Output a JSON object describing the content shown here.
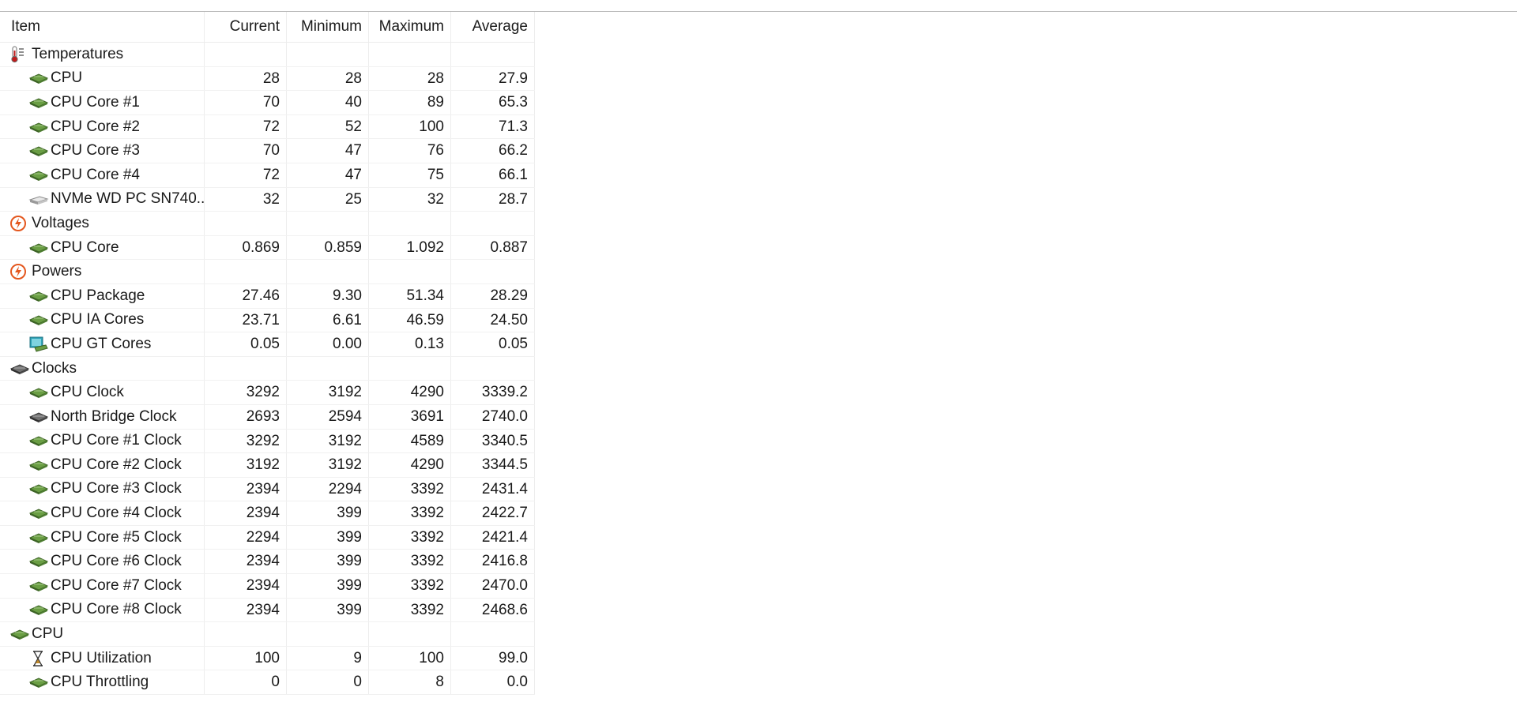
{
  "columns": {
    "item": "Item",
    "current": "Current",
    "minimum": "Minimum",
    "maximum": "Maximum",
    "average": "Average"
  },
  "rows": [
    {
      "kind": "category",
      "icon": "thermometer-icon",
      "label": "Temperatures",
      "current": "",
      "minimum": "",
      "maximum": "",
      "average": ""
    },
    {
      "kind": "item",
      "icon": "chip-icon",
      "label": "CPU",
      "current": "28",
      "minimum": "28",
      "maximum": "28",
      "average": "27.9"
    },
    {
      "kind": "item",
      "icon": "chip-icon",
      "label": "CPU Core #1",
      "current": "70",
      "minimum": "40",
      "maximum": "89",
      "average": "65.3"
    },
    {
      "kind": "item",
      "icon": "chip-icon",
      "label": "CPU Core #2",
      "current": "72",
      "minimum": "52",
      "maximum": "100",
      "average": "71.3"
    },
    {
      "kind": "item",
      "icon": "chip-icon",
      "label": "CPU Core #3",
      "current": "70",
      "minimum": "47",
      "maximum": "76",
      "average": "66.2"
    },
    {
      "kind": "item",
      "icon": "chip-icon",
      "label": "CPU Core #4",
      "current": "72",
      "minimum": "47",
      "maximum": "75",
      "average": "66.1"
    },
    {
      "kind": "item",
      "icon": "drive-icon",
      "label": "NVMe WD PC SN740...",
      "current": "32",
      "minimum": "25",
      "maximum": "32",
      "average": "28.7"
    },
    {
      "kind": "category",
      "icon": "lightning-icon",
      "label": "Voltages",
      "current": "",
      "minimum": "",
      "maximum": "",
      "average": ""
    },
    {
      "kind": "item",
      "icon": "chip-icon",
      "label": "CPU Core",
      "current": "0.869",
      "minimum": "0.859",
      "maximum": "1.092",
      "average": "0.887"
    },
    {
      "kind": "category",
      "icon": "lightning-icon",
      "label": "Powers",
      "current": "",
      "minimum": "",
      "maximum": "",
      "average": ""
    },
    {
      "kind": "item",
      "icon": "chip-icon",
      "label": "CPU Package",
      "current": "27.46",
      "minimum": "9.30",
      "maximum": "51.34",
      "average": "28.29"
    },
    {
      "kind": "item",
      "icon": "chip-icon",
      "label": "CPU IA Cores",
      "current": "23.71",
      "minimum": "6.61",
      "maximum": "46.59",
      "average": "24.50"
    },
    {
      "kind": "item",
      "icon": "gpu-icon",
      "label": "CPU GT Cores",
      "current": "0.05",
      "minimum": "0.00",
      "maximum": "0.13",
      "average": "0.05"
    },
    {
      "kind": "category",
      "icon": "dark-chip-icon",
      "label": "Clocks",
      "current": "",
      "minimum": "",
      "maximum": "",
      "average": ""
    },
    {
      "kind": "item",
      "icon": "chip-icon",
      "label": "CPU Clock",
      "current": "3292",
      "minimum": "3192",
      "maximum": "4290",
      "average": "3339.2"
    },
    {
      "kind": "item",
      "icon": "dark-chip-icon",
      "label": "North Bridge Clock",
      "current": "2693",
      "minimum": "2594",
      "maximum": "3691",
      "average": "2740.0"
    },
    {
      "kind": "item",
      "icon": "chip-icon",
      "label": "CPU Core #1 Clock",
      "current": "3292",
      "minimum": "3192",
      "maximum": "4589",
      "average": "3340.5"
    },
    {
      "kind": "item",
      "icon": "chip-icon",
      "label": "CPU Core #2 Clock",
      "current": "3192",
      "minimum": "3192",
      "maximum": "4290",
      "average": "3344.5"
    },
    {
      "kind": "item",
      "icon": "chip-icon",
      "label": "CPU Core #3 Clock",
      "current": "2394",
      "minimum": "2294",
      "maximum": "3392",
      "average": "2431.4"
    },
    {
      "kind": "item",
      "icon": "chip-icon",
      "label": "CPU Core #4 Clock",
      "current": "2394",
      "minimum": "399",
      "maximum": "3392",
      "average": "2422.7"
    },
    {
      "kind": "item",
      "icon": "chip-icon",
      "label": "CPU Core #5 Clock",
      "current": "2294",
      "minimum": "399",
      "maximum": "3392",
      "average": "2421.4"
    },
    {
      "kind": "item",
      "icon": "chip-icon",
      "label": "CPU Core #6 Clock",
      "current": "2394",
      "minimum": "399",
      "maximum": "3392",
      "average": "2416.8"
    },
    {
      "kind": "item",
      "icon": "chip-icon",
      "label": "CPU Core #7 Clock",
      "current": "2394",
      "minimum": "399",
      "maximum": "3392",
      "average": "2470.0"
    },
    {
      "kind": "item",
      "icon": "chip-icon",
      "label": "CPU Core #8 Clock",
      "current": "2394",
      "minimum": "399",
      "maximum": "3392",
      "average": "2468.6"
    },
    {
      "kind": "category",
      "icon": "chip-icon",
      "label": "CPU",
      "current": "",
      "minimum": "",
      "maximum": "",
      "average": ""
    },
    {
      "kind": "item",
      "icon": "hourglass-icon",
      "label": "CPU Utilization",
      "current": "100",
      "minimum": "9",
      "maximum": "100",
      "average": "99.0"
    },
    {
      "kind": "item",
      "icon": "chip-icon",
      "label": "CPU Throttling",
      "current": "0",
      "minimum": "0",
      "maximum": "8",
      "average": "0.0"
    }
  ],
  "colors": {
    "chip_green": "#5a8f3a",
    "lightning_orange": "#e4571e",
    "thermo_red": "#b01818",
    "gpu_teal": "#2fa4b8"
  }
}
